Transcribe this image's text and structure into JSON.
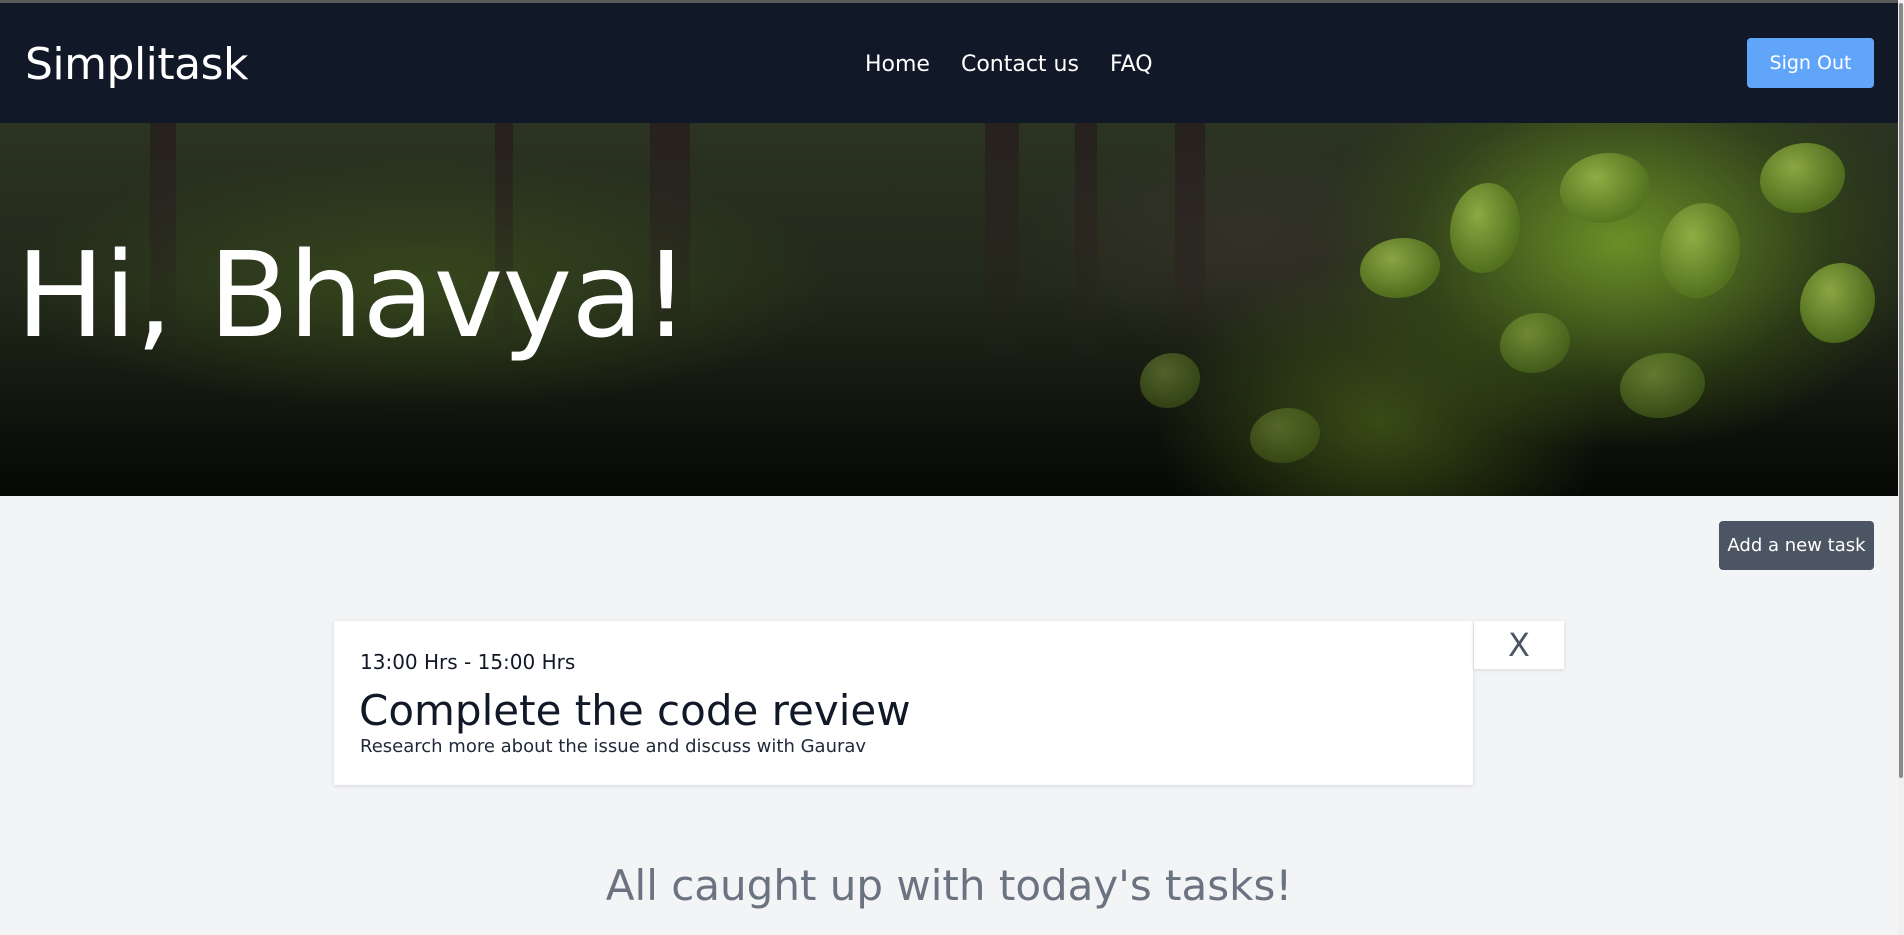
{
  "navbar": {
    "brand": "Simplitask",
    "links": [
      "Home",
      "Contact us",
      "FAQ"
    ],
    "sign_out_label": "Sign Out"
  },
  "hero": {
    "greeting": "Hi, Bhavya!"
  },
  "toolbar": {
    "add_task_label": "Add a new task"
  },
  "tasks": [
    {
      "time": "13:00 Hrs - 15:00 Hrs",
      "title": "Complete the code review",
      "description": "Research more about the issue and discuss with Gaurav",
      "delete_label": "X"
    }
  ],
  "status": {
    "caught_up": "All caught up with today's tasks!"
  },
  "colors": {
    "navbar_bg": "#111827",
    "sign_out_bg": "#60a5fa",
    "add_task_bg": "#4b5563",
    "page_bg": "#f3f4f6"
  }
}
